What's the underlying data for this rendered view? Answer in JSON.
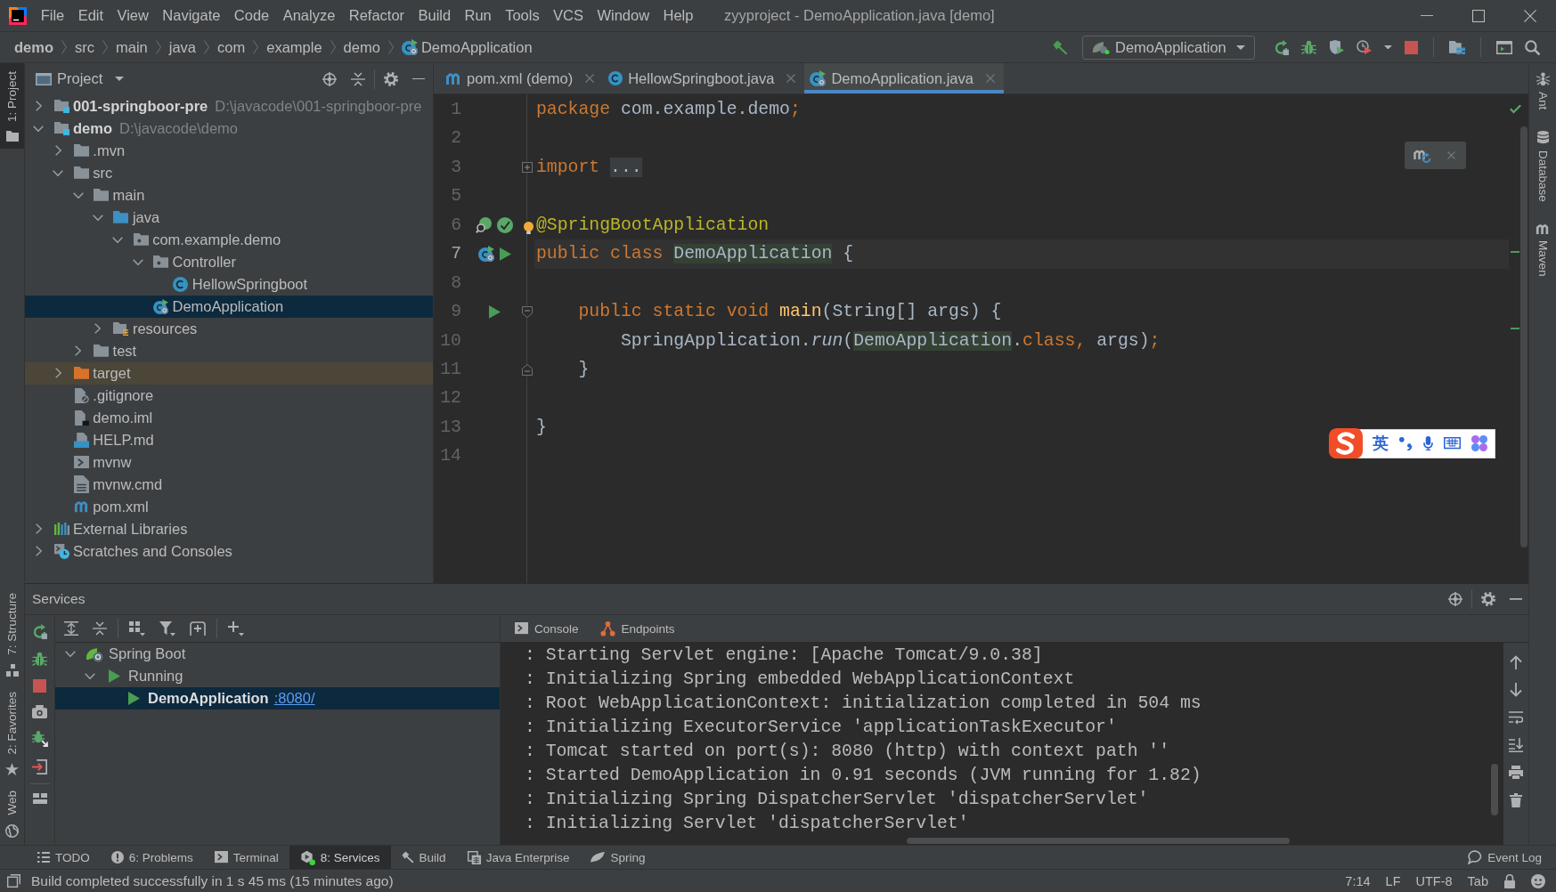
{
  "window": {
    "title": "zyyproject - DemoApplication.java [demo]"
  },
  "menu": [
    "File",
    "Edit",
    "View",
    "Navigate",
    "Code",
    "Analyze",
    "Refactor",
    "Build",
    "Run",
    "Tools",
    "VCS",
    "Window",
    "Help"
  ],
  "breadcrumbs": [
    {
      "label": "demo",
      "kind": "project"
    },
    {
      "label": "src",
      "kind": "dir"
    },
    {
      "label": "main",
      "kind": "dir"
    },
    {
      "label": "java",
      "kind": "dir"
    },
    {
      "label": "com",
      "kind": "dir"
    },
    {
      "label": "example",
      "kind": "dir"
    },
    {
      "label": "demo",
      "kind": "dir"
    },
    {
      "label": "DemoApplication",
      "kind": "app"
    }
  ],
  "run_config": {
    "label": "DemoApplication"
  },
  "left_stripe": {
    "top": [
      {
        "label": "1: Project",
        "kind": "project",
        "selected": true
      }
    ],
    "bottom": [
      {
        "label": "7: Structure",
        "kind": "structure",
        "selected": false
      },
      {
        "label": "2: Favorites",
        "kind": "favorites",
        "selected": false
      },
      {
        "label": "Web",
        "kind": "web",
        "selected": false
      }
    ]
  },
  "right_stripe": [
    {
      "label": "Ant",
      "kind": "ant"
    },
    {
      "label": "Database",
      "kind": "database"
    },
    {
      "label": "Maven",
      "kind": "maven"
    }
  ],
  "project_panel": {
    "title": "Project",
    "tree": [
      {
        "label": "001-springboor-pre",
        "path": "D:\\javacode\\001-springboor-pre",
        "kind": "module",
        "expanded": false,
        "selected": false
      },
      {
        "label": "demo",
        "path": "D:\\javacode\\demo",
        "kind": "module",
        "expanded": true,
        "selected": false,
        "children": [
          {
            "label": ".mvn",
            "kind": "folder",
            "expanded": false,
            "selected": false
          },
          {
            "label": "src",
            "kind": "folder",
            "expanded": true,
            "selected": false,
            "children": [
              {
                "label": "main",
                "kind": "folder",
                "expanded": true,
                "selected": false,
                "children": [
                  {
                    "label": "java",
                    "kind": "source_root",
                    "expanded": true,
                    "selected": false,
                    "children": [
                      {
                        "label": "com.example.demo",
                        "kind": "package",
                        "expanded": true,
                        "selected": false,
                        "children": [
                          {
                            "label": "Controller",
                            "kind": "package",
                            "expanded": true,
                            "selected": false,
                            "children": [
                              {
                                "label": "HellowSpringboot",
                                "kind": "class",
                                "selected": false
                              }
                            ]
                          },
                          {
                            "label": "DemoApplication",
                            "kind": "app",
                            "selected": true
                          }
                        ]
                      }
                    ]
                  },
                  {
                    "label": "resources",
                    "kind": "resources_root",
                    "expanded": false,
                    "selected": false
                  }
                ]
              },
              {
                "label": "test",
                "kind": "folder",
                "expanded": false,
                "selected": false
              }
            ]
          },
          {
            "label": "target",
            "kind": "excluded",
            "expanded": false,
            "selected": false
          },
          {
            "label": ".gitignore",
            "kind": "ignore_file",
            "selected": false
          },
          {
            "label": "demo.iml",
            "kind": "module_file",
            "selected": false
          },
          {
            "label": "HELP.md",
            "kind": "markdown",
            "selected": false
          },
          {
            "label": "mvnw",
            "kind": "script",
            "selected": false
          },
          {
            "label": "mvnw.cmd",
            "kind": "text",
            "selected": false
          },
          {
            "label": "pom.xml",
            "kind": "maven",
            "selected": false
          }
        ]
      },
      {
        "label": "External Libraries",
        "kind": "libraries",
        "expanded": false,
        "selected": false
      },
      {
        "label": "Scratches and Consoles",
        "kind": "scratches",
        "expanded": false,
        "selected": false
      }
    ]
  },
  "editor": {
    "tabs": [
      {
        "label": "pom.xml (demo)",
        "kind": "maven",
        "selected": false
      },
      {
        "label": "HellowSpringboot.java",
        "kind": "class",
        "selected": false
      },
      {
        "label": "DemoApplication.java",
        "kind": "app",
        "selected": true
      }
    ],
    "lines": [
      {
        "number": "1",
        "current": false,
        "intention": false,
        "tokens": [
          {
            "kind": "keyword",
            "text": "package"
          },
          {
            "kind": "plain",
            "text": " com.example.demo"
          },
          {
            "kind": "keyword",
            "text": ";"
          }
        ]
      },
      {
        "number": "2",
        "current": false,
        "intention": false
      },
      {
        "number": "3",
        "current": false,
        "intention": false,
        "fold_mark": {
          "kind": "collapsed"
        },
        "tokens": [
          {
            "kind": "keyword",
            "text": "import "
          },
          {
            "kind": "folded",
            "text": "..."
          }
        ]
      },
      {
        "number": "5",
        "current": false,
        "intention": false
      },
      {
        "number": "6",
        "current": false,
        "intention": true,
        "gutter": [
          {
            "kind": "autowired"
          },
          {
            "kind": "bean"
          }
        ],
        "tokens": [
          {
            "kind": "annotation",
            "text": "@SpringBootApplication"
          }
        ]
      },
      {
        "number": "7",
        "current": true,
        "intention": false,
        "gutter": [
          {
            "kind": "app"
          },
          {
            "kind": "run"
          }
        ],
        "tokens": [
          {
            "kind": "keyword",
            "text": "public class "
          },
          {
            "kind": "usage",
            "text": "DemoApplication"
          },
          {
            "kind": "plain",
            "text": " {"
          }
        ]
      },
      {
        "number": "8",
        "current": false,
        "intention": false
      },
      {
        "number": "9",
        "current": false,
        "intention": false,
        "fold_mark": {
          "kind": "start"
        },
        "gutter": [
          {
            "kind": "run"
          }
        ],
        "tokens": [
          {
            "kind": "keyword",
            "text": "    public static void "
          },
          {
            "kind": "method",
            "text": "main"
          },
          {
            "kind": "plain",
            "text": "(String[] args) {"
          }
        ]
      },
      {
        "number": "10",
        "current": false,
        "intention": false,
        "tokens": [
          {
            "kind": "plain",
            "text": "        SpringApplication."
          },
          {
            "kind": "static",
            "text": "run"
          },
          {
            "kind": "plain",
            "text": "("
          },
          {
            "kind": "usage",
            "text": "DemoApplication"
          },
          {
            "kind": "plain",
            "text": "."
          },
          {
            "kind": "keyword",
            "text": "class,"
          },
          {
            "kind": "plain",
            "text": " args)"
          },
          {
            "kind": "keyword",
            "text": ";"
          }
        ]
      },
      {
        "number": "11",
        "current": false,
        "intention": false,
        "fold_mark": {
          "kind": "end"
        },
        "tokens": [
          {
            "kind": "plain",
            "text": "    }"
          }
        ]
      },
      {
        "number": "12",
        "current": false,
        "intention": false
      },
      {
        "number": "13",
        "current": false,
        "intention": false,
        "tokens": [
          {
            "kind": "plain",
            "text": "}"
          }
        ]
      },
      {
        "number": "14",
        "current": false,
        "intention": false
      }
    ],
    "ime_toolbar": {
      "mode": "英"
    }
  },
  "services": {
    "title": "Services",
    "tree": [
      {
        "label": "Spring Boot",
        "kind": "framework",
        "expanded": true,
        "selected": false,
        "children": [
          {
            "label": "Running",
            "kind": "state",
            "expanded": true,
            "selected": false,
            "children": [
              {
                "label": "DemoApplication",
                "link": ":8080/",
                "kind": "app",
                "selected": true
              }
            ]
          }
        ]
      }
    ],
    "console_tabs": [
      {
        "label": "Console",
        "kind": "console"
      },
      {
        "label": "Endpoints",
        "kind": "endpoints"
      }
    ],
    "console_lines": [
      ": Starting Servlet engine: [Apache Tomcat/9.0.38]",
      ": Initializing Spring embedded WebApplicationContext",
      ": Root WebApplicationContext: initialization completed in 504 ms",
      ": Initializing ExecutorService 'applicationTaskExecutor'",
      ": Tomcat started on port(s): 8080 (http) with context path ''",
      ": Started DemoApplication in 0.91 seconds (JVM running for 1.82)",
      ": Initializing Spring DispatcherServlet 'dispatcherServlet'",
      ": Initializing Servlet 'dispatcherServlet'"
    ]
  },
  "tool_windows": {
    "left": [
      {
        "label": "TODO",
        "kind": "todo",
        "selected": false
      },
      {
        "label": "6: Problems",
        "kind": "problems",
        "selected": false
      },
      {
        "label": "Terminal",
        "kind": "terminal",
        "selected": false
      },
      {
        "label": "8: Services",
        "kind": "services",
        "selected": true
      },
      {
        "label": "Build",
        "kind": "build",
        "selected": false
      },
      {
        "label": "Java Enterprise",
        "kind": "javaee",
        "selected": false
      },
      {
        "label": "Spring",
        "kind": "spring",
        "selected": false
      }
    ],
    "right": [
      {
        "label": "Event Log",
        "kind": "events",
        "selected": false
      }
    ]
  },
  "status_bar": {
    "message": "Build completed successfully in 1 s 45 ms (15 minutes ago)",
    "caret": "7:14",
    "line_separator": "LF",
    "encoding": "UTF-8",
    "indent": "Tab"
  }
}
